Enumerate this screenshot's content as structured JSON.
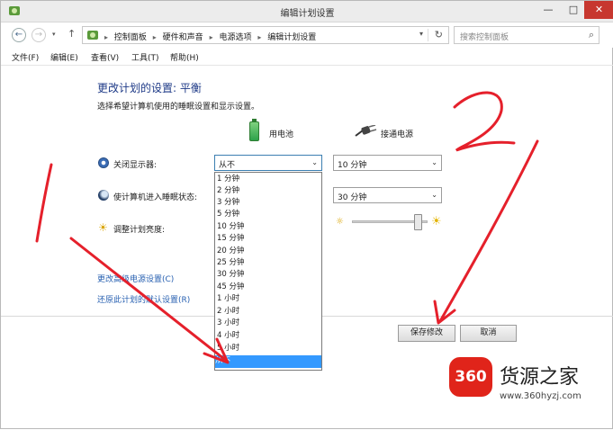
{
  "window": {
    "title": "编辑计划设置",
    "controls": [
      "—",
      "□",
      "✕"
    ]
  },
  "nav": {
    "back": "←",
    "forward": "→",
    "dropdown": "▾",
    "up": "↑",
    "breadcrumbs": [
      "控制面板",
      "硬件和声音",
      "电源选项",
      "编辑计划设置"
    ],
    "separator": "▸",
    "address_dropdown": "▾",
    "refresh": "↻",
    "search_placeholder": "搜索控制面板",
    "search_icon": "⌕"
  },
  "menubar": {
    "items": [
      "文件(F)",
      "编辑(E)",
      "查看(V)",
      "工具(T)",
      "帮助(H)"
    ]
  },
  "main": {
    "heading": "更改计划的设置: 平衡",
    "subheading": "选择希望计算机使用的睡眠设置和显示设置。",
    "columns": {
      "battery": "用电池",
      "plugged": "接通电源"
    },
    "rows": {
      "display_off": {
        "label": "关闭显示器:",
        "battery_value": "从不",
        "plugged_value": "10 分钟"
      },
      "sleep": {
        "label": "使计算机进入睡眠状态:",
        "plugged_value": "30 分钟"
      },
      "brightness": {
        "label": "调整计划亮度:"
      }
    },
    "dropdown_options": [
      "1 分钟",
      "2 分钟",
      "3 分钟",
      "5 分钟",
      "10 分钟",
      "15 分钟",
      "20 分钟",
      "25 分钟",
      "30 分钟",
      "45 分钟",
      "1 小时",
      "2 小时",
      "3 小时",
      "4 小时",
      "5 小时",
      "从不"
    ],
    "highlighted_option": "从不",
    "links": {
      "advanced": "更改高级电源设置(C)",
      "restore": "还原此计划的默认设置(R)"
    },
    "buttons": {
      "save": "保存修改",
      "cancel": "取消"
    },
    "dropdown_arrow": "⌄"
  },
  "annotations": {
    "color": "#e5202b",
    "marks": [
      "1",
      "2"
    ]
  },
  "watermark": {
    "logo_text": "360",
    "brand": "货源之家",
    "url": "www.360hyzj.com"
  }
}
